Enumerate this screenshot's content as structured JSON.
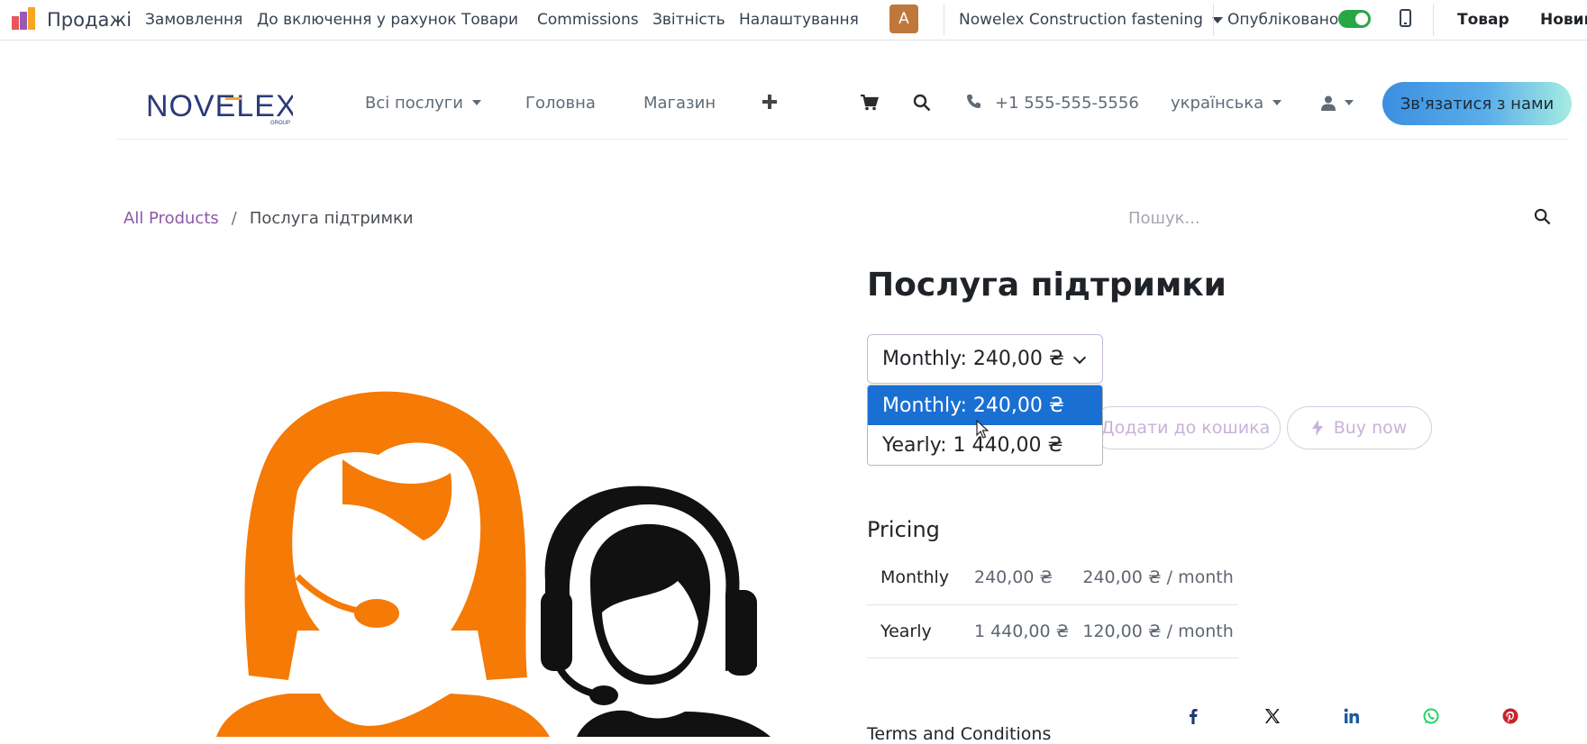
{
  "topbar": {
    "app_name": "Продажі",
    "menu": [
      "Замовлення",
      "До включення у рахунок",
      "Товари",
      "Commissions",
      "Звітність",
      "Налаштування"
    ],
    "avatar_letter": "A",
    "website_name": "Nowelex Construction fastening",
    "published_label": "Опубліковано",
    "published": true,
    "product_link": "Товар",
    "new_link": "Новий"
  },
  "header": {
    "logo_text": "NOVELEX",
    "logo_subtext": "GROUP",
    "nav": {
      "all_services": "Всі послуги",
      "home": "Головна",
      "shop": "Магазин"
    },
    "phone": "+1 555-555-5556",
    "language": "українська",
    "contact_button": "Зв'язатися з нами"
  },
  "breadcrumb": {
    "all_products": "All Products",
    "separator": "/",
    "current": "Послуга підтримки"
  },
  "search": {
    "placeholder": "Пошук..."
  },
  "product": {
    "title": "Послуга підтримки",
    "selected_variant": "Monthly: 240,00 ₴",
    "options": [
      "Monthly: 240,00 ₴",
      "Yearly: 1 440,00 ₴"
    ],
    "add_to_cart": "Додати до кошика",
    "buy_now": "Buy now",
    "pricing_title": "Pricing",
    "pricing": [
      {
        "plan": "Monthly",
        "price": "240,00 ₴",
        "per_month": "240,00 ₴ / month"
      },
      {
        "plan": "Yearly",
        "price": "1 440,00 ₴",
        "per_month": "120,00 ₴ / month"
      }
    ],
    "terms_partial": "Terms and Conditions"
  },
  "share": [
    "facebook-icon",
    "x-icon",
    "linkedin-icon",
    "whatsapp-icon",
    "pinterest-icon"
  ],
  "colors": {
    "accent_purple": "#8c5aa8",
    "selected_blue": "#1a6fd3",
    "toggle_green": "#28a745",
    "avatar_brown": "#c0773b",
    "illustration_orange": "#f57a06"
  }
}
